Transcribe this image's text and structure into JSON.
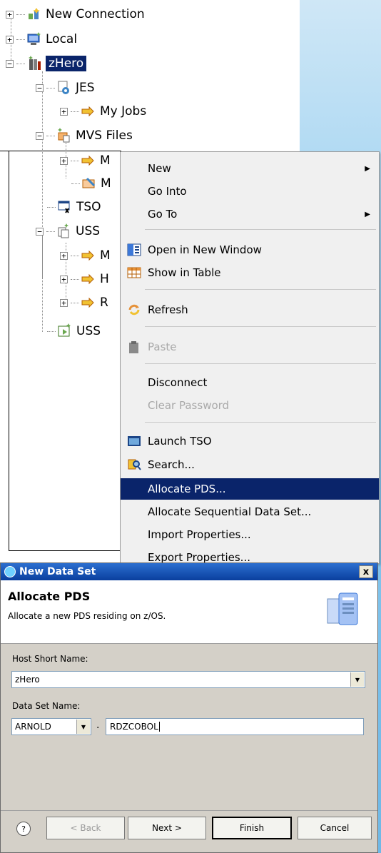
{
  "tree": {
    "items": [
      {
        "label": "New Connection",
        "icon": "new-connection-icon",
        "expander": "+"
      },
      {
        "label": "Local",
        "icon": "local-computer-icon",
        "expander": "+"
      },
      {
        "label": "zHero",
        "icon": "zos-system-icon",
        "expander": "−",
        "selected": true
      },
      {
        "label": "JES",
        "icon": "jes-icon",
        "expander": "−"
      },
      {
        "label": "My Jobs",
        "icon": "filter-icon",
        "expander": "+"
      },
      {
        "label": "MVS Files",
        "icon": "mvs-files-icon",
        "expander": "−"
      },
      {
        "label": "M",
        "icon": "filter-icon",
        "expander": "+"
      },
      {
        "label": "M",
        "icon": "retrieve-dataset-icon",
        "expander": ""
      },
      {
        "label": "TSO",
        "icon": "tso-icon",
        "expander": ""
      },
      {
        "label": "USS",
        "icon": "uss-files-icon",
        "expander": "−"
      },
      {
        "label": "M",
        "icon": "filter-icon",
        "expander": "+"
      },
      {
        "label": "H",
        "icon": "filter-icon",
        "expander": "+"
      },
      {
        "label": "R",
        "icon": "filter-icon",
        "expander": "+"
      },
      {
        "label": "USS",
        "icon": "uss-shell-icon",
        "expander": ""
      }
    ]
  },
  "context_menu": {
    "items": [
      {
        "label": "New",
        "submenu": true
      },
      {
        "label": "Go Into"
      },
      {
        "label": "Go To",
        "submenu": true
      },
      {
        "label": "Open in New Window",
        "icon": "new-window-icon"
      },
      {
        "label": "Show in Table",
        "icon": "table-icon"
      },
      {
        "label": "Refresh",
        "icon": "refresh-icon"
      },
      {
        "label": "Paste",
        "icon": "paste-icon",
        "disabled": true
      },
      {
        "label": "Disconnect"
      },
      {
        "label": "Clear Password",
        "disabled": true
      },
      {
        "label": "Launch TSO",
        "icon": "terminal-icon"
      },
      {
        "label": "Search...",
        "icon": "search-icon"
      },
      {
        "label": "Allocate PDS...",
        "highlighted": true
      },
      {
        "label": "Allocate Sequential Data Set..."
      },
      {
        "label": "Import Properties..."
      },
      {
        "label": "Export Properties..."
      }
    ]
  },
  "dialog": {
    "title": "New Data Set",
    "close_glyph": "x",
    "header_title": "Allocate PDS",
    "header_desc": "Allocate a new PDS residing on z/OS.",
    "host_label": "Host Short Name:",
    "host_value": "zHero",
    "dsn_label": "Data Set Name:",
    "hlq_value": "ARNOLD",
    "dot": ".",
    "llq_value": "RDZCOBOL",
    "help_glyph": "?",
    "back_label": "< Back",
    "next_label": "Next >",
    "finish_label": "Finish",
    "cancel_label": "Cancel"
  },
  "colors": {
    "selection": "#0a246a",
    "titlebar": "#0a3f9e"
  }
}
